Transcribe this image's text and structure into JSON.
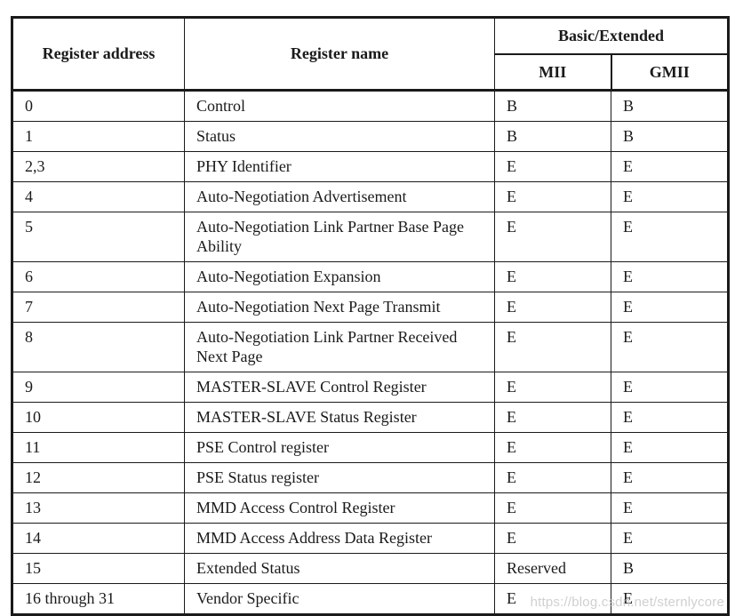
{
  "table": {
    "headers": {
      "address": "Register address",
      "name": "Register name",
      "group": "Basic/Extended",
      "mii": "MII",
      "gmii": "GMII"
    },
    "rows": [
      {
        "address": "0",
        "name": "Control",
        "mii": "B",
        "gmii": "B"
      },
      {
        "address": "1",
        "name": "Status",
        "mii": "B",
        "gmii": "B"
      },
      {
        "address": "2,3",
        "name": "PHY Identifier",
        "mii": "E",
        "gmii": "E"
      },
      {
        "address": "4",
        "name": "Auto-Negotiation Advertisement",
        "mii": "E",
        "gmii": "E"
      },
      {
        "address": "5",
        "name": "Auto-Negotiation Link Partner Base Page Ability",
        "mii": "E",
        "gmii": "E"
      },
      {
        "address": "6",
        "name": "Auto-Negotiation Expansion",
        "mii": "E",
        "gmii": "E"
      },
      {
        "address": "7",
        "name": "Auto-Negotiation Next Page Transmit",
        "mii": "E",
        "gmii": "E"
      },
      {
        "address": "8",
        "name": "Auto-Negotiation Link Partner Received Next Page",
        "mii": "E",
        "gmii": "E"
      },
      {
        "address": "9",
        "name": "MASTER-SLAVE Control Register",
        "mii": "E",
        "gmii": "E"
      },
      {
        "address": "10",
        "name": "MASTER-SLAVE Status Register",
        "mii": "E",
        "gmii": "E"
      },
      {
        "address": "11",
        "name": "PSE Control register",
        "mii": "E",
        "gmii": "E"
      },
      {
        "address": "12",
        "name": "PSE Status register",
        "mii": "E",
        "gmii": "E"
      },
      {
        "address": "13",
        "name": "MMD Access Control Register",
        "mii": "E",
        "gmii": "E"
      },
      {
        "address": "14",
        "name": "MMD Access Address Data Register",
        "mii": "E",
        "gmii": "E"
      },
      {
        "address": "15",
        "name": "Extended Status",
        "mii": "Reserved",
        "gmii": "B"
      },
      {
        "address": "16 through 31",
        "name": "Vendor Specific",
        "mii": "E",
        "gmii": "E"
      }
    ]
  },
  "watermark": "https://blog.csdn.net/sternlycore"
}
